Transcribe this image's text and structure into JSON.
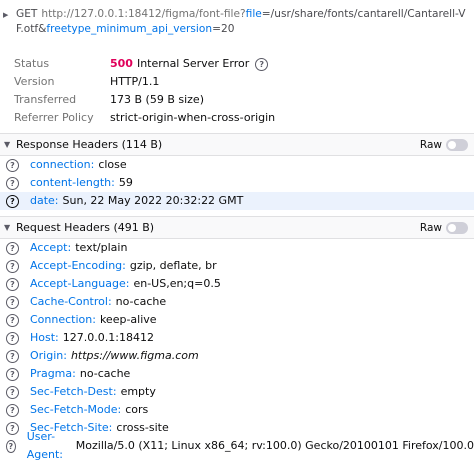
{
  "request": {
    "method": "GET",
    "url_base": "http://127.0.0.1:18412/figma/font-file?",
    "param1_key": "file",
    "param1_val": "=/usr/share/fonts/cantarell/Cantarell-VF.otf&",
    "param2_key": "freetype_minimum_api_version",
    "param2_val": "=20"
  },
  "summary": {
    "status_label": "Status",
    "status_code": "500",
    "status_text": "Internal Server Error",
    "version_label": "Version",
    "version_value": "HTTP/1.1",
    "transferred_label": "Transferred",
    "transferred_value": "173 B (59 B size)",
    "referrer_label": "Referrer Policy",
    "referrer_value": "strict-origin-when-cross-origin"
  },
  "response_headers": {
    "title": "Response Headers (114 B)",
    "raw_label": "Raw",
    "items": [
      {
        "name": "connection:",
        "value": "close"
      },
      {
        "name": "content-length:",
        "value": "59"
      },
      {
        "name": "date:",
        "value": "Sun, 22 May 2022 20:32:22 GMT"
      }
    ]
  },
  "request_headers": {
    "title": "Request Headers (491 B)",
    "raw_label": "Raw",
    "items": [
      {
        "name": "Accept:",
        "value": "text/plain"
      },
      {
        "name": "Accept-Encoding:",
        "value": "gzip, deflate, br"
      },
      {
        "name": "Accept-Language:",
        "value": "en-US,en;q=0.5"
      },
      {
        "name": "Cache-Control:",
        "value": "no-cache"
      },
      {
        "name": "Connection:",
        "value": "keep-alive"
      },
      {
        "name": "Host:",
        "value": "127.0.0.1:18412"
      },
      {
        "name": "Origin:",
        "value": "https://www.figma.com"
      },
      {
        "name": "Pragma:",
        "value": "no-cache"
      },
      {
        "name": "Sec-Fetch-Dest:",
        "value": "empty"
      },
      {
        "name": "Sec-Fetch-Mode:",
        "value": "cors"
      },
      {
        "name": "Sec-Fetch-Site:",
        "value": "cross-site"
      },
      {
        "name": "User-Agent:",
        "value": "Mozilla/5.0 (X11; Linux x86_64; rv:100.0) Gecko/20100101 Firefox/100.0"
      }
    ]
  },
  "icons": {
    "help": "?",
    "collapse": "▶",
    "expand": "▼"
  },
  "colors": {
    "status_error": "#e0005a",
    "header_name": "#0074e8",
    "selected_row": "#ebf2fd"
  }
}
